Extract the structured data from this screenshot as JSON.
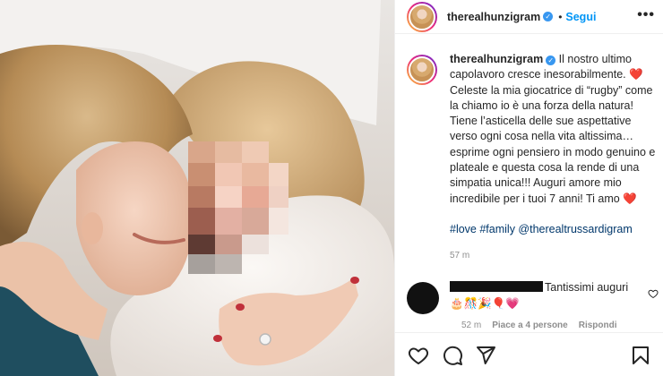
{
  "post": {
    "username": "therealhunzigram",
    "follow_label": "Segui",
    "more_label": "•••",
    "caption_text": "Il nostro ultimo capolavoro cresce inesorabilmente. ",
    "caption_text2": " Celeste la mia giocatrice di “rugby” come la chiamo io è una forza della natura! Tiene l’asticella delle sue aspettative verso ogni cosa nella vita altissima…esprime ogni pensiero in modo genuino e plateale e questa cosa la rende di una simpatia unica!!! Auguri amore mio incredibile per i tuoi 7 anni! Ti amo ",
    "heart_emoji": "❤️",
    "hashtags": "#love #family @therealtrussardigram",
    "time_ago": "57 m"
  },
  "comment": {
    "text": "Tantissimi auguri 🎂🎊🎉🎈💗",
    "time": "52 m",
    "likes": "Piace a 4 persone",
    "reply": "Rispondi"
  },
  "icons": [
    "verified-badge",
    "more-icon",
    "heart-icon",
    "comment-icon",
    "share-icon",
    "bookmark-icon"
  ]
}
